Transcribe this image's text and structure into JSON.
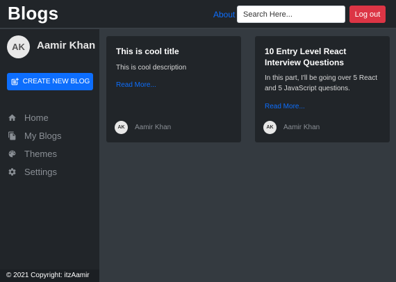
{
  "navbar": {
    "brand": "Blogs",
    "about_label": "About",
    "search_placeholder": "Search Here...",
    "logout_label": "Log out"
  },
  "sidebar": {
    "avatar_initials": "AK",
    "user_name": "Aamir Khan",
    "create_label": "CREATE NEW BLOG",
    "items": [
      {
        "label": "Home",
        "icon": "home-icon"
      },
      {
        "label": "My Blogs",
        "icon": "documents-icon"
      },
      {
        "label": "Themes",
        "icon": "palette-icon"
      },
      {
        "label": "Settings",
        "icon": "gear-icon"
      }
    ]
  },
  "cards": [
    {
      "title": "This is cool title",
      "description": "This is cool description",
      "read_more": "Read More...",
      "author_initials": "AK",
      "author": "Aamir Khan"
    },
    {
      "title": "10 Entry Level React Interview Questions",
      "description": "In this part, I'll be going over 5 React and 5 JavaScript questions.",
      "read_more": "Read More...",
      "author_initials": "AK",
      "author": "Aamir Khan"
    }
  ],
  "footer": {
    "text": "© 2021 Copyright: itzAamir"
  },
  "colors": {
    "background": "#343a40",
    "panel": "#212529",
    "primary": "#0d6efd",
    "danger": "#dc3545",
    "muted": "#8a8f95"
  }
}
